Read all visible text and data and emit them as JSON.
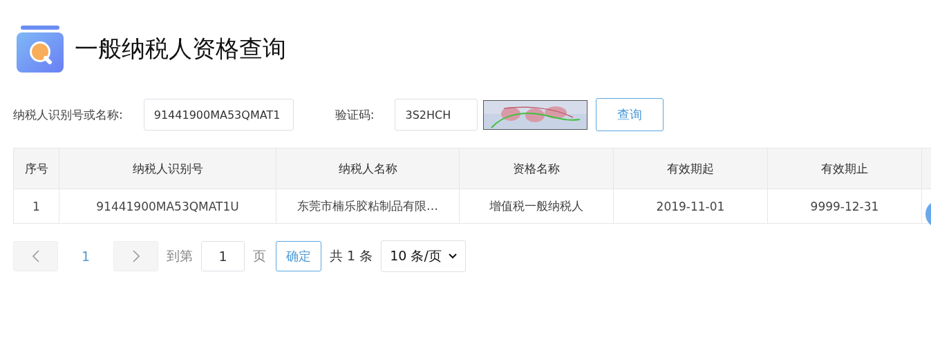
{
  "header": {
    "title": "一般纳税人资格查询"
  },
  "form": {
    "id_label": "纳税人识别号或名称:",
    "id_value": "91441900MA53QMAT1",
    "captcha_label": "验证码:",
    "captcha_value": "3S2HCH",
    "query_button": "查询"
  },
  "table": {
    "columns": [
      "序号",
      "纳税人识别号",
      "纳税人名称",
      "资格名称",
      "有效期起",
      "有效期止"
    ],
    "rows": [
      [
        "1",
        "91441900MA53QMAT1U",
        "东莞市楠乐胶粘制品有限…",
        "增值税一般纳税人",
        "2019-11-01",
        "9999-12-31"
      ]
    ]
  },
  "pagination": {
    "pages": [
      {
        "label": "1",
        "selected": true
      }
    ],
    "goto_label": "到第",
    "goto_value": "1",
    "page_unit": "页",
    "confirm_button": "确定",
    "total": "共 1 条",
    "page_size": "10 条/页"
  }
}
